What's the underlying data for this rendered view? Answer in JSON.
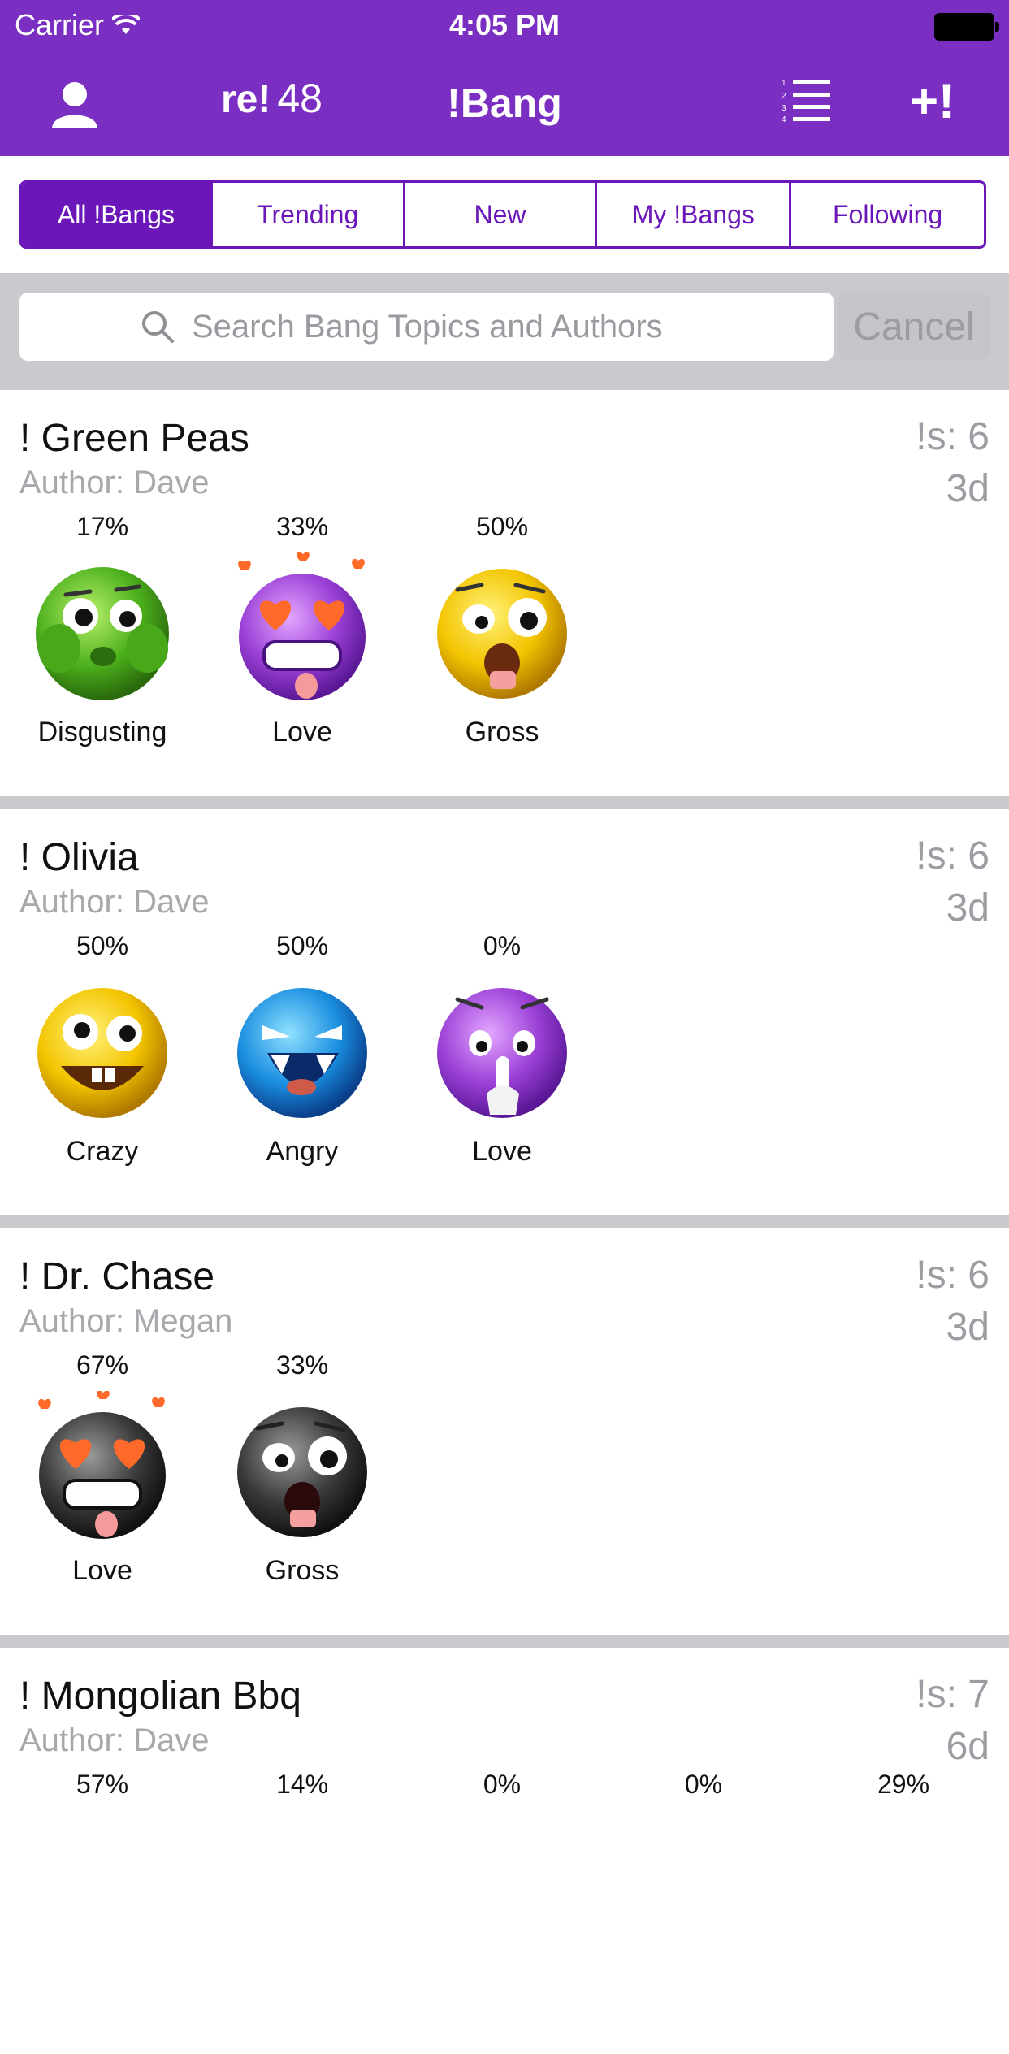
{
  "status": {
    "carrier": "Carrier",
    "time": "4:05 PM"
  },
  "nav": {
    "re_word": "re!",
    "re_count": "48",
    "title": "!Bang",
    "add_label": "+!"
  },
  "tabs": [
    "All !Bangs",
    "Trending",
    "New",
    "My !Bangs",
    "Following"
  ],
  "active_tab": 0,
  "search": {
    "placeholder": "Search Bang Topics and Authors",
    "cancel": "Cancel"
  },
  "colors": {
    "brand": "#7a2fc2",
    "segment": "#6a16b8"
  },
  "posts": [
    {
      "title": "! Green Peas",
      "author": "Author: Dave",
      "count": "!s: 6",
      "age": "3d",
      "reactions": [
        {
          "pct": "17%",
          "label": "Disgusting",
          "icon": "green-disgusted-face-icon"
        },
        {
          "pct": "33%",
          "label": "Love",
          "icon": "purple-heart-eyes-face-icon"
        },
        {
          "pct": "50%",
          "label": "Gross",
          "icon": "yellow-gross-face-icon"
        }
      ]
    },
    {
      "title": "! Olivia",
      "author": "Author: Dave",
      "count": "!s: 6",
      "age": "3d",
      "reactions": [
        {
          "pct": "50%",
          "label": "Crazy",
          "icon": "yellow-crazy-face-icon"
        },
        {
          "pct": "50%",
          "label": "Angry",
          "icon": "blue-angry-face-icon"
        },
        {
          "pct": "0%",
          "label": "Love",
          "icon": "purple-shush-face-icon"
        }
      ]
    },
    {
      "title": "! Dr. Chase",
      "author": "Author: Megan",
      "count": "!s: 6",
      "age": "3d",
      "reactions": [
        {
          "pct": "67%",
          "label": "Love",
          "icon": "black-heart-eyes-face-icon"
        },
        {
          "pct": "33%",
          "label": "Gross",
          "icon": "black-gross-face-icon"
        }
      ]
    },
    {
      "title": "! Mongolian Bbq",
      "author": "Author: Dave",
      "count": "!s: 7",
      "age": "6d",
      "reactions": [
        {
          "pct": "57%"
        },
        {
          "pct": "14%"
        },
        {
          "pct": "0%"
        },
        {
          "pct": "0%"
        },
        {
          "pct": "29%"
        }
      ]
    }
  ]
}
